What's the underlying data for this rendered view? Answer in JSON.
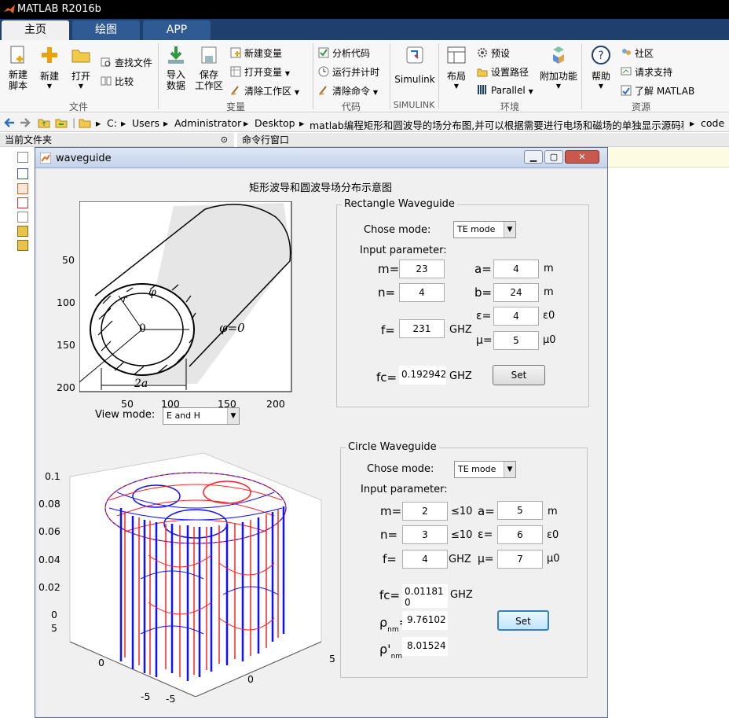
{
  "app": {
    "title": "MATLAB R2016b"
  },
  "tabs": [
    {
      "label": "主页"
    },
    {
      "label": "绘图"
    },
    {
      "label": "APP"
    }
  ],
  "ribbon": {
    "file": {
      "new_script": "新建\n脚本",
      "new": "新建",
      "open": "打开",
      "find_files": "查找文件",
      "compare": "比较",
      "group": "文件"
    },
    "variable": {
      "import": "导入\n数据",
      "save_ws": "保存\n工作区",
      "new_var": "新建变量",
      "open_var": "打开变量",
      "clear_ws": "清除工作区",
      "group": "变量"
    },
    "code": {
      "analyze": "分析代码",
      "run_time": "运行并计时",
      "clear_cmd": "清除命令",
      "group": "代码"
    },
    "simulink": {
      "label": "Simulink",
      "group": "SIMULINK"
    },
    "env": {
      "layout": "布局",
      "prefs": "预设",
      "set_path": "设置路径",
      "parallel": "Parallel",
      "addons": "附加功能",
      "group": "环境"
    },
    "resources": {
      "help": "帮助",
      "community": "社区",
      "support": "请求支持",
      "learn": "了解 MATLAB",
      "group": "资源"
    }
  },
  "address": {
    "crumbs": [
      "C:",
      "Users",
      "Administrator",
      "Desktop",
      "matlab编程矩形和圆波导的场分布图,并可以根据需要进行电场和磁场的单独显示源码程序",
      "code"
    ]
  },
  "panels": {
    "current_folder": "当前文件夹",
    "command_window": "命令行窗口"
  },
  "figure": {
    "title": "waveguide",
    "heading": "矩形波导和圆波导场分布示意图",
    "img_axis": {
      "x_ticks": [
        "50",
        "100",
        "150",
        "200"
      ],
      "y_ticks": [
        "50",
        "100",
        "150",
        "200"
      ]
    },
    "view_mode": {
      "label": "View mode:",
      "value": "E and H"
    },
    "plot3d": {
      "z_ticks": [
        "0.1",
        "0.08",
        "0.06",
        "0.04",
        "0.02",
        "0"
      ],
      "y_ticks": [
        "5",
        "0",
        "-5"
      ],
      "x_ticks": [
        "-5",
        "0",
        "5"
      ]
    }
  },
  "rect": {
    "title": "Rectangle Waveguide",
    "chose_mode_label": "Chose mode:",
    "mode": "TE mode",
    "input_label": "Input parameter:",
    "m_label": "m=",
    "m": "23",
    "n_label": "n=",
    "n": "4",
    "f_label": "f=",
    "f": "231",
    "f_unit": "GHZ",
    "a_label": "a=",
    "a": "4",
    "a_unit": "m",
    "b_label": "b=",
    "b": "24",
    "b_unit": "m",
    "eps_label": "ε=",
    "eps": "4",
    "eps_unit": "ε0",
    "mu_label": "μ=",
    "mu": "5",
    "mu_unit": "μ0",
    "fc_label": "fc=",
    "fc": "0.192942",
    "fc_unit": "GHZ",
    "set": "Set"
  },
  "circle": {
    "title": "Circle Waveguide",
    "chose_mode_label": "Chose mode:",
    "mode": "TE mode",
    "input_label": "Input parameter:",
    "m_label": "m=",
    "m": "2",
    "m_limit": "≤10",
    "n_label": "n=",
    "n": "3",
    "n_limit": "≤10",
    "f_label": "f=",
    "f": "4",
    "f_unit": "GHZ",
    "a_label": "a=",
    "a": "5",
    "a_unit": "m",
    "eps_label": "ε=",
    "eps": "6",
    "eps_unit": "ε0",
    "mu_label": "μ=",
    "mu": "7",
    "mu_unit": "μ0",
    "fc_label": "fc=",
    "fc": "0.011810",
    "fc_unit": "GHZ",
    "rho_label": "ρ",
    "rho_sub": "nm",
    "rho": "9.76102",
    "rhop_label": "ρ'",
    "rhop_sub": "nm",
    "rhop": "8.01524",
    "set": "Set"
  },
  "img_labels": {
    "r": "r",
    "phi": "φ",
    "zero": "0",
    "phi0": "φ=0",
    "twoa": "2a"
  },
  "colors": {
    "titlebar": "#000000",
    "tabbar": "#1f3f6e",
    "e_field": "#ff2020",
    "h_field": "#1010ff"
  }
}
